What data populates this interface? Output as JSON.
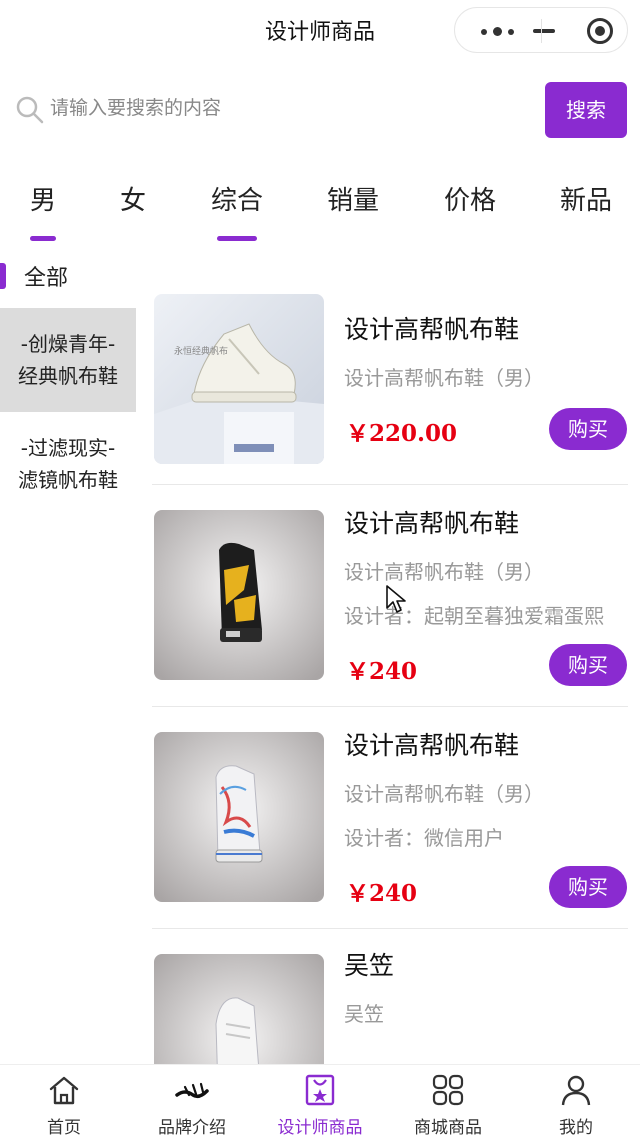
{
  "header": {
    "title": "设计师商品"
  },
  "search": {
    "placeholder": "请输入要搜索的内容",
    "button_label": "搜索"
  },
  "tabs": [
    {
      "label": "男",
      "active": true
    },
    {
      "label": "女",
      "active": false
    },
    {
      "label": "综合",
      "active": true
    },
    {
      "label": "销量",
      "active": false
    },
    {
      "label": "价格",
      "active": false
    },
    {
      "label": "新品",
      "active": false
    }
  ],
  "sidebar": {
    "all_label": "全部",
    "items": [
      {
        "line1": "-创燥青年-",
        "line2": "经典帆布鞋",
        "active": true
      },
      {
        "line1": "-过滤现实-",
        "line2": "滤镜帆布鞋",
        "active": false
      }
    ]
  },
  "products": [
    {
      "name": "设计高帮帆布鞋",
      "subtitle": "设计高帮帆布鞋（男）",
      "designer": "",
      "price": "￥220.00",
      "buy_label": "购买"
    },
    {
      "name": "设计高帮帆布鞋",
      "subtitle": "设计高帮帆布鞋（男）",
      "designer": "设计者：起朝至暮独爱霜蛋熙",
      "price": "￥240",
      "buy_label": "购买"
    },
    {
      "name": "设计高帮帆布鞋",
      "subtitle": "设计高帮帆布鞋（男）",
      "designer": "设计者：微信用户",
      "price": "￥240",
      "buy_label": "购买"
    },
    {
      "name": "吴笠",
      "subtitle": "吴笠",
      "designer": "",
      "price": "",
      "buy_label": ""
    }
  ],
  "bottom_nav": [
    {
      "label": "首页",
      "icon": "home-icon",
      "active": false
    },
    {
      "label": "品牌介绍",
      "icon": "brand-logo-icon",
      "active": false
    },
    {
      "label": "设计师商品",
      "icon": "designer-shirt-icon",
      "active": true
    },
    {
      "label": "商城商品",
      "icon": "grid-icon",
      "active": false
    },
    {
      "label": "我的",
      "icon": "user-icon",
      "active": false
    }
  ],
  "colors": {
    "accent": "#8a2bd0",
    "price": "#e60012",
    "muted": "#999999",
    "selected_category_bg": "#dcdcdc"
  }
}
